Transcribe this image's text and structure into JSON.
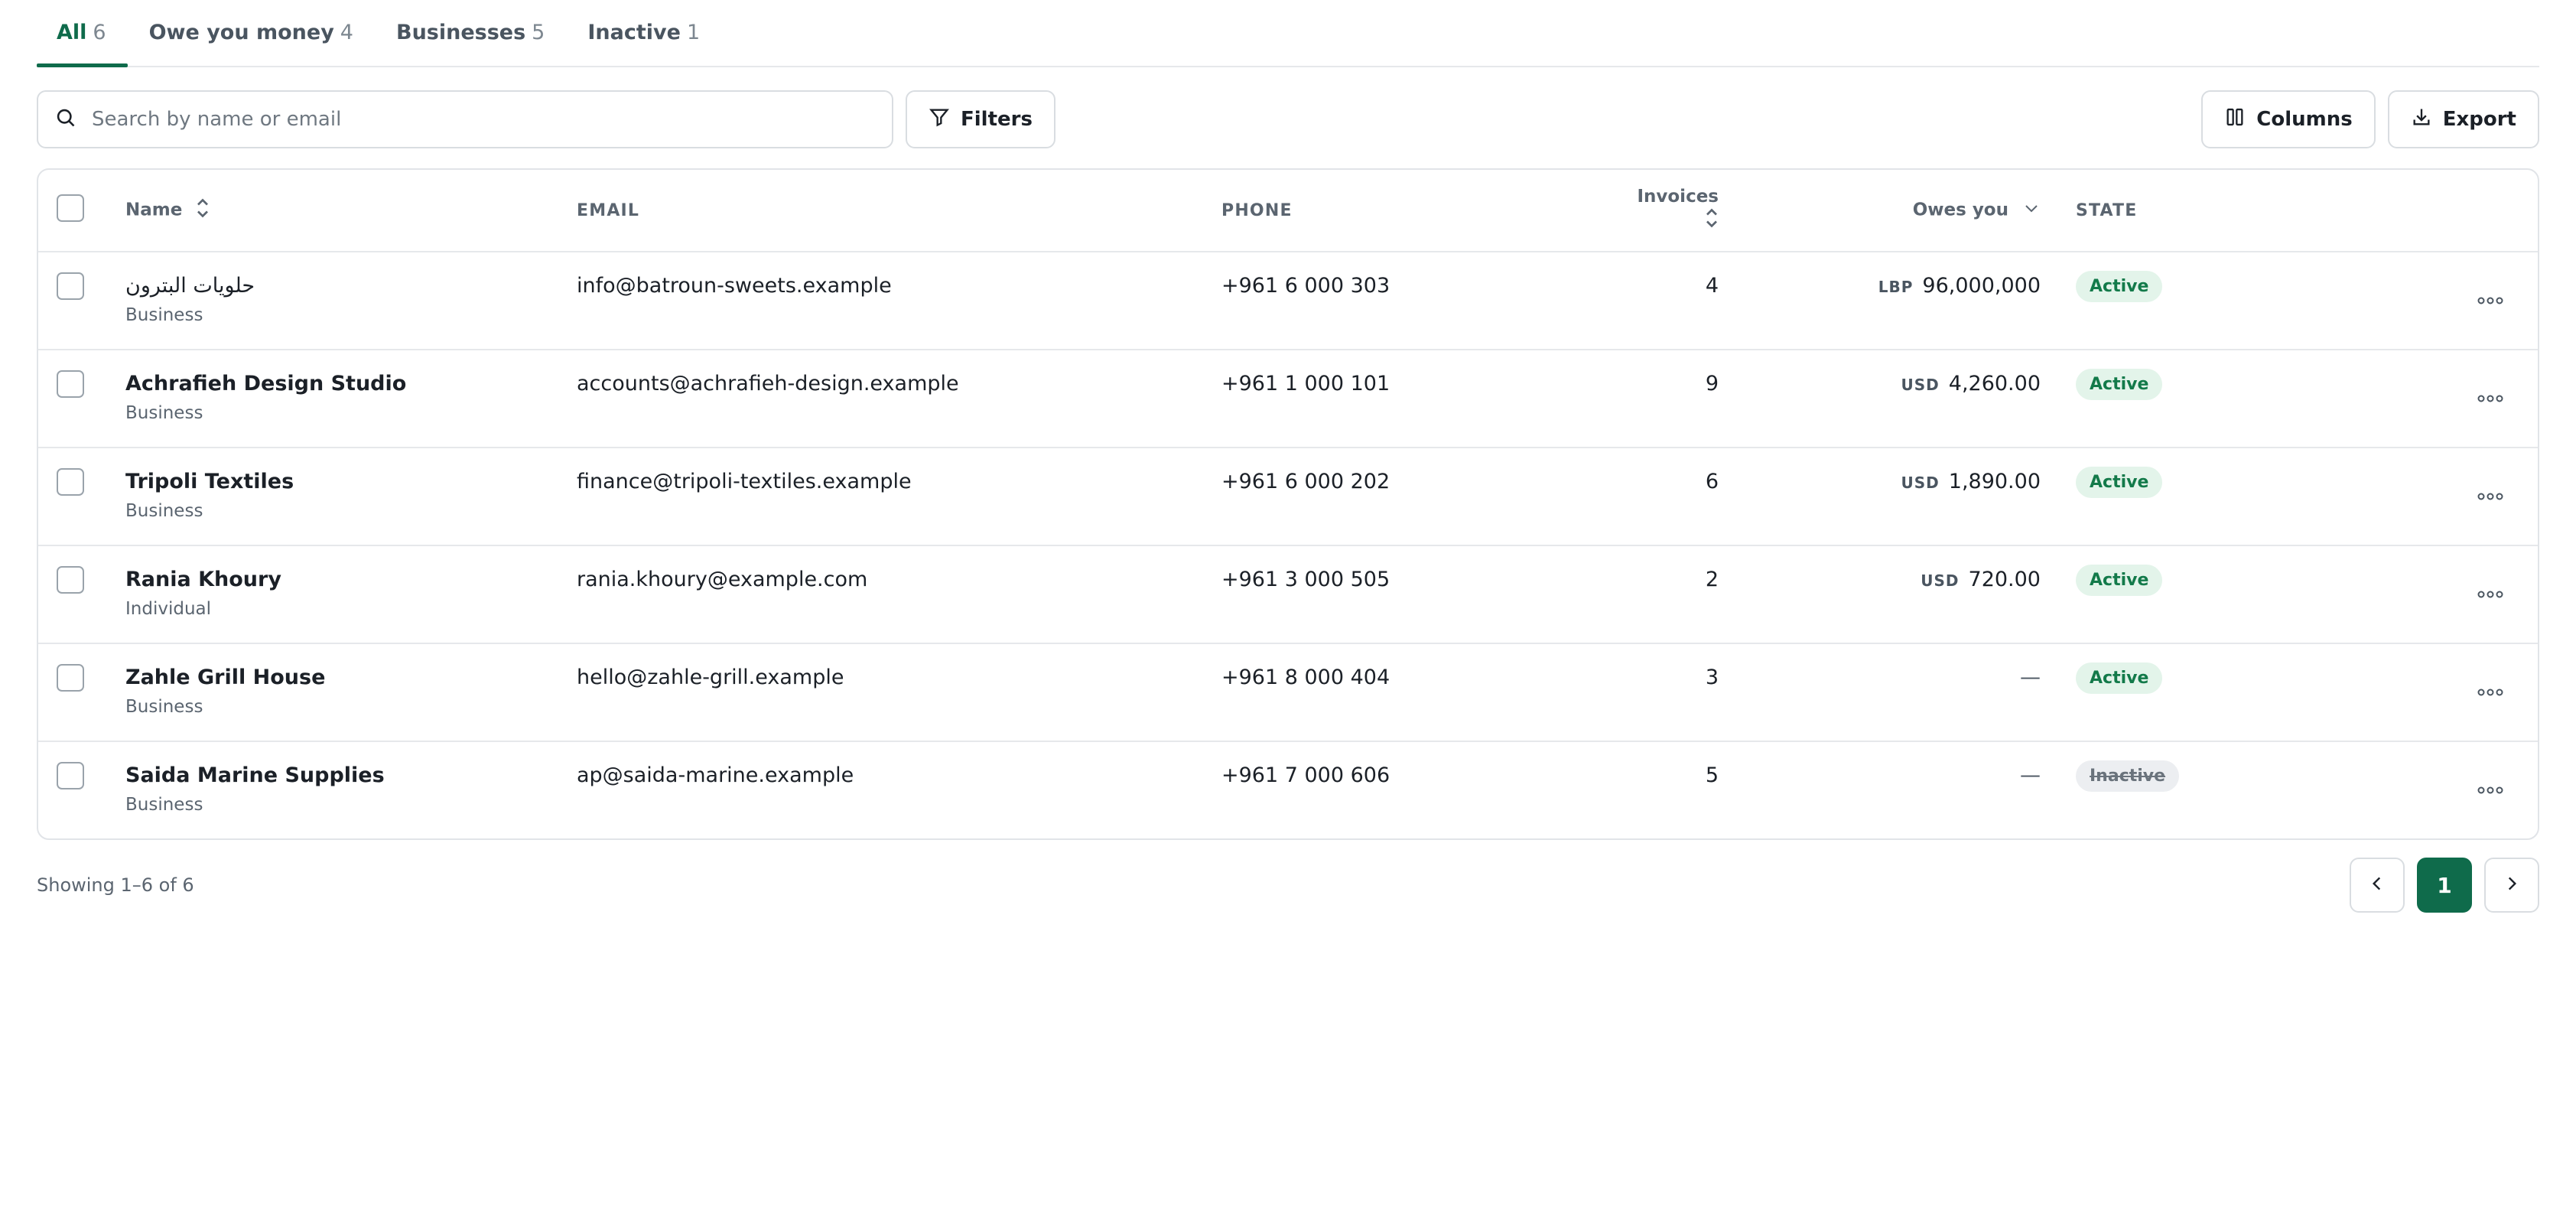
{
  "tabs": [
    {
      "label": "All",
      "count": "6",
      "active": true
    },
    {
      "label": "Owe you money",
      "count": "4"
    },
    {
      "label": "Businesses",
      "count": "5"
    },
    {
      "label": "Inactive",
      "count": "1"
    }
  ],
  "toolbar": {
    "search_placeholder": "Search by name or email",
    "filters_label": "Filters",
    "columns_label": "Columns",
    "export_label": "Export"
  },
  "table": {
    "headers": {
      "name": "Name",
      "email": "EMAIL",
      "phone": "PHONE",
      "invoices": "Invoices",
      "owes": "Owes you",
      "state": "STATE"
    },
    "rows": [
      {
        "name": "حلويات البترون",
        "type": "Business",
        "email": "info@batroun-sweets.example",
        "phone": "+961 6 000 303",
        "invoices": "4",
        "currency": "LBP",
        "amount": "96,000,000",
        "state": "Active"
      },
      {
        "name": "Achrafieh Design Studio",
        "type": "Business",
        "email": "accounts@achrafieh-design.example",
        "phone": "+961 1 000 101",
        "invoices": "9",
        "currency": "USD",
        "amount": "4,260.00",
        "state": "Active"
      },
      {
        "name": "Tripoli Textiles",
        "type": "Business",
        "email": "finance@tripoli-textiles.example",
        "phone": "+961 6 000 202",
        "invoices": "6",
        "currency": "USD",
        "amount": "1,890.00",
        "state": "Active"
      },
      {
        "name": "Rania Khoury",
        "type": "Individual",
        "email": "rania.khoury@example.com",
        "phone": "+961 3 000 505",
        "invoices": "2",
        "currency": "USD",
        "amount": "720.00",
        "state": "Active"
      },
      {
        "name": "Zahle Grill House",
        "type": "Business",
        "email": "hello@zahle-grill.example",
        "phone": "+961 8 000 404",
        "invoices": "3",
        "currency": "",
        "amount": "—",
        "state": "Active"
      },
      {
        "name": "Saida Marine Supplies",
        "type": "Business",
        "email": "ap@saida-marine.example",
        "phone": "+961 7 000 606",
        "invoices": "5",
        "currency": "",
        "amount": "—",
        "state": "Inactive"
      }
    ]
  },
  "footer": {
    "showing": "Showing 1–6 of 6",
    "current_page": "1"
  },
  "colors": {
    "accent": "#0f6b4b",
    "active_badge_bg": "#e3f4ea",
    "active_badge_text": "#137a4a",
    "inactive_badge_bg": "#eceef1"
  }
}
